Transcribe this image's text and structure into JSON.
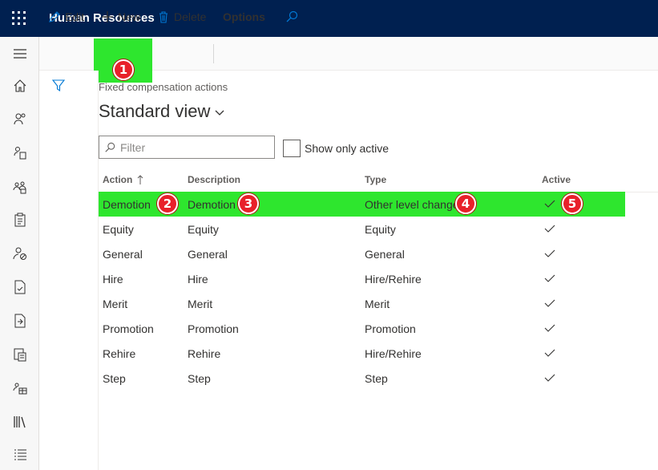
{
  "app": {
    "title": "Human Resources"
  },
  "actions": {
    "edit": "Edit",
    "new": "New",
    "delete": "Delete",
    "options": "Options"
  },
  "page": {
    "breadcrumb": "Fixed compensation actions",
    "view_title": "Standard view"
  },
  "filter": {
    "placeholder": "Filter",
    "value": ""
  },
  "show_only_active": {
    "label": "Show only active",
    "checked": false
  },
  "grid": {
    "columns": [
      "Action",
      "Description",
      "Type",
      "Active"
    ],
    "sort": {
      "column": "Action",
      "direction": "ascending"
    },
    "rows": [
      {
        "action": "Demotion",
        "description": "Demotion",
        "type": "Other level change",
        "active": true,
        "selected": true
      },
      {
        "action": "Equity",
        "description": "Equity",
        "type": "Equity",
        "active": true
      },
      {
        "action": "General",
        "description": "General",
        "type": "General",
        "active": true
      },
      {
        "action": "Hire",
        "description": "Hire",
        "type": "Hire/Rehire",
        "active": true
      },
      {
        "action": "Merit",
        "description": "Merit",
        "type": "Merit",
        "active": true
      },
      {
        "action": "Promotion",
        "description": "Promotion",
        "type": "Promotion",
        "active": true
      },
      {
        "action": "Rehire",
        "description": "Rehire",
        "type": "Hire/Rehire",
        "active": true
      },
      {
        "action": "Step",
        "description": "Step",
        "type": "Step",
        "active": true
      }
    ]
  },
  "markers": [
    "1",
    "2",
    "3",
    "4",
    "5"
  ],
  "nav_icons": [
    "home-icon",
    "people-icon",
    "person-doc-icon",
    "team-icon",
    "clipboard-icon",
    "person-block-icon",
    "doc-check-icon",
    "doc-arrow-icon",
    "doc-money-icon",
    "people-table-icon",
    "library-icon",
    "list-icon"
  ],
  "colors": {
    "topbar": "#002050",
    "highlight": "#2ee62e",
    "marker": "#e8202a"
  }
}
